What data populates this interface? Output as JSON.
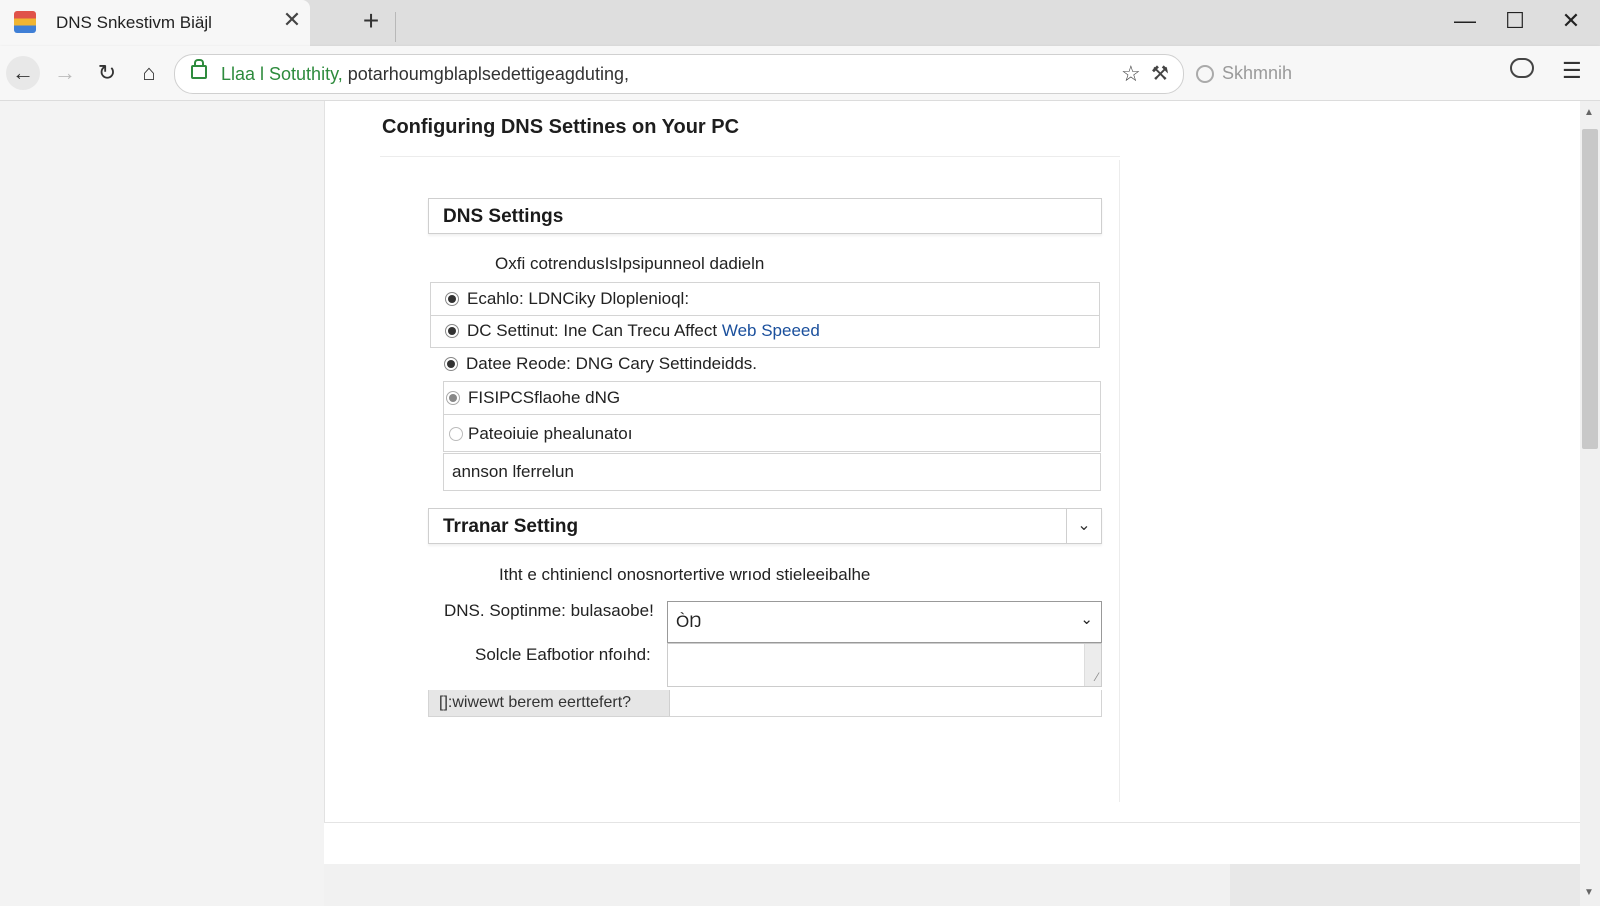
{
  "tab": {
    "title": "DNS Snkestivm Biäjl",
    "close": "✕",
    "new_tab": "+"
  },
  "window": {
    "minimize": "—",
    "maximize": "☐",
    "close": "✕"
  },
  "toolbar": {
    "back": "←",
    "forward": "→",
    "reload": "↻",
    "home": "⌂",
    "url_secure": "Llaa l Sotuthity,",
    "url_rest": " potarhoumgblaplsedettigeagduting,",
    "bookmark_star": "☆",
    "extension": "⚒",
    "search_placeholder": "Skhmnih",
    "menu": "☰"
  },
  "page": {
    "title": "Configuring DNS Settines on Your PC",
    "dns_panel": {
      "header": "DNS Settings",
      "description": "Oxfi cotrendusIsIpsipunneol dadieln",
      "options": [
        {
          "label": "Ecahlo: LDNCiky Dloplenioql:",
          "link": "",
          "checked": true
        },
        {
          "label": "DC Settinut: Ine Can Trecu  Affect ",
          "link": "Web Speeed",
          "checked": true
        },
        {
          "label": "Datee Reode: DNG Cary Settindeidds.",
          "link": "",
          "checked": true
        },
        {
          "label": "FISIPCSflaohe dNG",
          "link": "",
          "checked": true
        },
        {
          "label": "Pateoiuie phealunatoı",
          "link": "",
          "checked": false
        }
      ],
      "extra_row": "annson lferrelun"
    },
    "transfer_panel": {
      "header": "Trranar Setting",
      "description": "Itht e chtiniencl onosnortertive wrıod stieleeibalhe",
      "dns_label": "DNS. Soptinme: bulasaobe!",
      "dns_value": "ÒŊ",
      "method_label": "Solcle Eafbotior nfoıhd:",
      "method_value": "",
      "footer_button": "[]:wiwewt berem eerttefert?"
    }
  }
}
